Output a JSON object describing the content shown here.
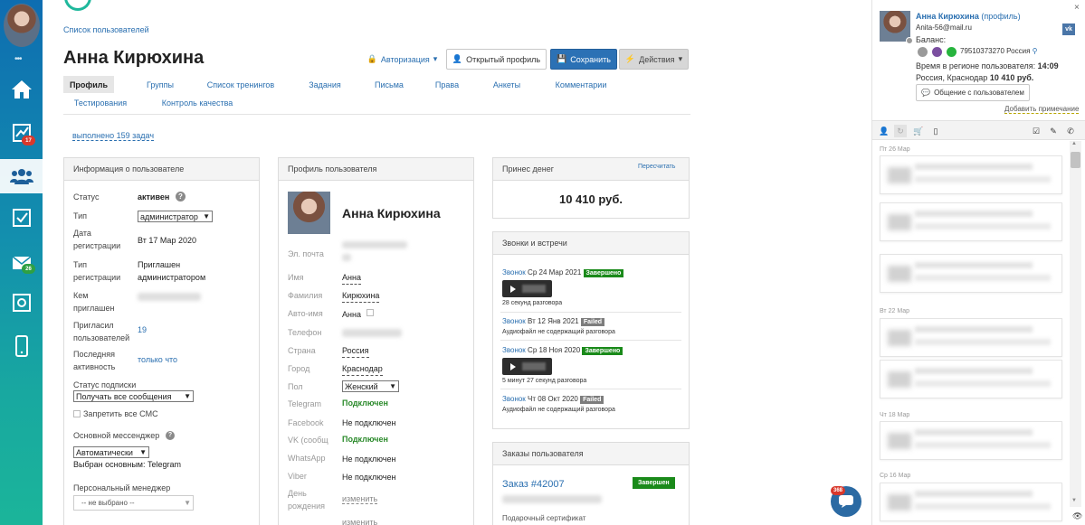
{
  "sidebar": {
    "badges": {
      "tasks": "17",
      "mail": "26"
    },
    "items": [
      {
        "icon": "home-icon"
      },
      {
        "icon": "chart-icon"
      },
      {
        "icon": "users-icon"
      },
      {
        "icon": "checkbox-icon"
      },
      {
        "icon": "mail-icon"
      },
      {
        "icon": "safe-icon"
      },
      {
        "icon": "phone-icon"
      }
    ]
  },
  "header": {
    "breadcrumb": "Список пользователей",
    "title": "Анна Кирюхина",
    "buttons": {
      "auth": "Авторизация",
      "open_profile": "Открытый профиль",
      "save": "Сохранить",
      "actions": "Действия"
    }
  },
  "tabs": [
    {
      "label": "Профиль",
      "active": true
    },
    {
      "label": "Группы"
    },
    {
      "label": "Список тренингов"
    },
    {
      "label": "Задания"
    },
    {
      "label": "Письма"
    },
    {
      "label": "Права"
    },
    {
      "label": "Анкеты"
    },
    {
      "label": "Комментарии"
    },
    {
      "label": "Тестирования"
    },
    {
      "label": "Контроль качества"
    }
  ],
  "tasks_done": "выполнено 159 задач",
  "user_info": {
    "title": "Информация о пользователе",
    "status_label": "Статус",
    "status_value": "активен",
    "type_label": "Тип",
    "type_value": "администратор",
    "reg_date_label_1": "Дата",
    "reg_date_label_2": "регистрации",
    "reg_date_value": "Вт 17 Мар 2020",
    "reg_type_label_1": "Тип",
    "reg_type_label_2": "регистрации",
    "reg_type_value_1": "Приглашен",
    "reg_type_value_2": "администратором",
    "invited_by_label_1": "Кем",
    "invited_by_label_2": "приглашен",
    "invited_label_1": "Пригласил",
    "invited_label_2": "пользователей",
    "invited_value": "19",
    "last_activity_label_1": "Последняя",
    "last_activity_label_2": "активность",
    "last_activity_value": "только что",
    "subscription_label": "Статус подписки",
    "subscription_value": "Получать все сообщения",
    "ban_sms": "Запретить все СМС",
    "messenger_label": "Основной мессенджер",
    "messenger_value": "Автоматически",
    "messenger_chosen": "Выбран основным: Telegram",
    "manager_label": "Персональный менеджер",
    "manager_value": "-- не выбрано --"
  },
  "profile": {
    "title": "Профиль пользователя",
    "name_big": "Анна Кирюхина",
    "fields": [
      {
        "label": "Эл. почта",
        "value": ""
      },
      {
        "label": "Имя",
        "value": "Анна"
      },
      {
        "label": "Фамилия",
        "value": "Кирюхина"
      },
      {
        "label": "Авто-имя",
        "value": "Анна"
      },
      {
        "label": "Телефон",
        "value": ""
      },
      {
        "label": "Страна",
        "value": "Россия"
      },
      {
        "label": "Город",
        "value": "Краснодар"
      },
      {
        "label": "Пол",
        "value": "Женский"
      },
      {
        "label": "Telegram",
        "value": "Подключен"
      },
      {
        "label": "Facebook",
        "value": "Не подключен"
      },
      {
        "label": "VK (сообщ",
        "value": "Подключен"
      },
      {
        "label": "WhatsApp",
        "value": "Не подключен"
      },
      {
        "label": "Viber",
        "value": "Не подключен"
      },
      {
        "label": "День",
        "value": "изменить"
      },
      {
        "label": "рождения",
        "value": ""
      },
      {
        "label": "",
        "value": "изменить"
      }
    ]
  },
  "money": {
    "title": "Принес денег",
    "recalc": "Пересчитать",
    "amount": "10 410 руб."
  },
  "calls": {
    "title": "Звонки и встречи",
    "items": [
      {
        "link": "Звонок",
        "date": "Ср 24 Мар 2021",
        "status": "Завершено",
        "status_color": "#1a8a1a",
        "note": "28 секунд разговора"
      },
      {
        "link": "Звонок",
        "date": "Вт 12 Янв 2021",
        "status": "Failed",
        "status_color": "#7d7d7d",
        "note": "Аудиофайл не содержащий разговора"
      },
      {
        "link": "Звонок",
        "date": "Ср 18 Ноя 2020",
        "status": "Завершено",
        "status_color": "#1a8a1a",
        "note": "5 минут 27 секунд разговора"
      },
      {
        "link": "Звонок",
        "date": "Чт 08 Окт 2020",
        "status": "Failed",
        "status_color": "#7d7d7d",
        "note": "Аудиофайл не содержащий разговора"
      }
    ]
  },
  "orders": {
    "title": "Заказы пользователя",
    "order_title": "Заказ #42007",
    "order_status": "Завершен",
    "order_item": "Подарочный сертификат"
  },
  "right_panel": {
    "name": "Анна Кирюхина",
    "profile_link": "(профиль)",
    "email": "Anita-56@mail.ru",
    "balance_label": "Баланс:",
    "phone": "79510373270 Россия",
    "region_time_label": "Время в регионе пользователя:",
    "region_time": "14:09",
    "location": "Россия, Краснодар",
    "money": "10 410 руб.",
    "contact_button": "Общение с пользователем",
    "add_note": "Добавить примечание",
    "feed_dates": [
      "Пт 26 Мар",
      "Вт 22 Мар",
      "Чт 18 Мар",
      "Ср 16 Мар"
    ]
  },
  "chat_badge": "368",
  "colors": {
    "primary": "#2b71b5",
    "link": "#2a6fb0",
    "success": "#1a8a1a",
    "sidebar_top": "#0e6db1",
    "sidebar_bottom": "#1bb59a"
  }
}
